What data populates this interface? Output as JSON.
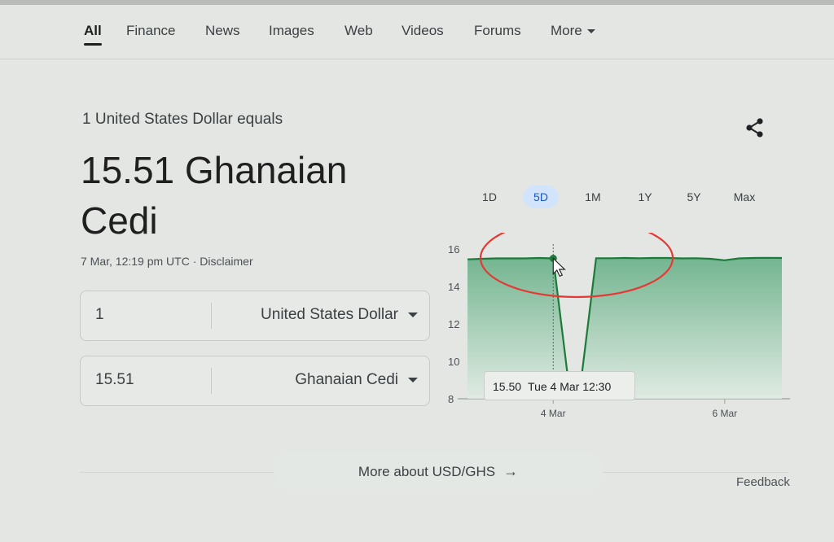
{
  "tabs": [
    {
      "label": "All",
      "active": true
    },
    {
      "label": "Finance"
    },
    {
      "label": "News"
    },
    {
      "label": "Images"
    },
    {
      "label": "Web"
    },
    {
      "label": "Videos"
    },
    {
      "label": "Forums"
    },
    {
      "label": "More"
    }
  ],
  "result": {
    "equals_text": "1 United States Dollar equals",
    "value_text": "15.51 Ghanaian Cedi",
    "timestamp": "7 Mar, 12:19 pm UTC",
    "separator": "·",
    "disclaimer": "Disclaimer"
  },
  "converter": {
    "from_amount": "1",
    "from_currency": "United States Dollar",
    "to_amount": "15.51",
    "to_currency": "Ghanaian Cedi"
  },
  "range_tabs": [
    "1D",
    "5D",
    "1M",
    "1Y",
    "5Y",
    "Max"
  ],
  "range_selected": "5D",
  "tooltip": {
    "value": "15.50",
    "label": "Tue 4 Mar 12:30"
  },
  "chart_data": {
    "type": "area",
    "y_ticks": [
      8,
      10,
      12,
      14,
      16
    ],
    "ylim": [
      8,
      16
    ],
    "x_ticks": [
      "4 Mar",
      "6 Mar"
    ],
    "series": [
      {
        "values": [
          15.45,
          15.48,
          15.5,
          15.5,
          15.5,
          15.52,
          15.5,
          9.3,
          9.3,
          15.51,
          15.51,
          15.52,
          15.51,
          15.52,
          15.52,
          15.5,
          15.51,
          15.48,
          15.4,
          15.5,
          15.52,
          15.53,
          15.52
        ]
      }
    ],
    "hover_index": 6,
    "colors": {
      "line": "#1e7a3b",
      "fill_top": "#4fa575",
      "fill_bottom": "#dfece3"
    }
  },
  "more_link": "More about USD/GHS",
  "feedback": "Feedback",
  "icons": {
    "share": "share-icon",
    "dropdown": "chevron-down-icon",
    "arrow": "arrow-right-icon"
  }
}
